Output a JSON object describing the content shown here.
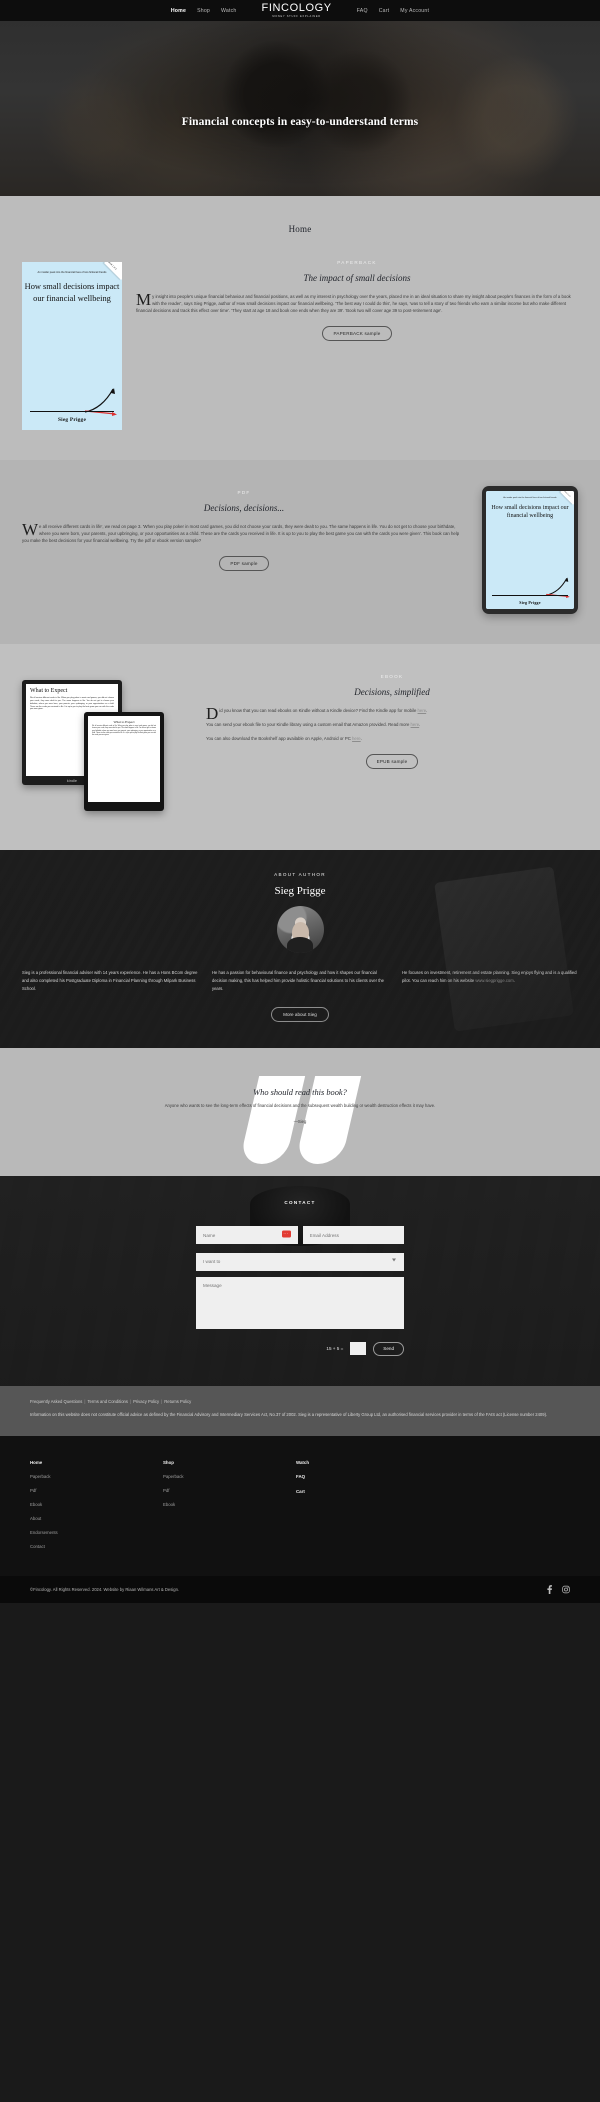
{
  "nav": {
    "left_links": [
      {
        "label": "Home",
        "active": true
      },
      {
        "label": "Shop",
        "active": false
      },
      {
        "label": "Watch",
        "active": false
      }
    ],
    "logo": "FINCOLOGY",
    "logo_tagline": "MONEY STUFF EXPLAINED",
    "right_links": [
      {
        "label": "FAQ"
      },
      {
        "label": "Cart"
      },
      {
        "label": "My Account"
      }
    ]
  },
  "hero": {
    "title": "Financial concepts in easy-to-understand terms"
  },
  "page": {
    "heading": "Home"
  },
  "book_cover": {
    "kicker": "An insider peek into the financial lives of two fictional friends",
    "title": "How small decisions impact our financial wellbeing",
    "author": "Sieg Prigge",
    "corner_badge": "Book 1 of 2"
  },
  "paperback": {
    "eyebrow": "PAPERBACK",
    "title": "The impact of small decisions",
    "dropcap": "M",
    "body": "y insight into people's unique financial behaviour and financial positions, as well as my interest in psychology over the years, placed me in an ideal situation to share my insight about people's finances in the form of a book with the reader', says Sieg Prigge, author of How small decisions impact our financial wellbeing. 'The best way I could do this', he says, 'was to tell a story of two friends who earn a similar income but who make different financial decisions and track this effect over time'. 'They start at age 18 and book one ends when they are 39'. 'Book two will cover age 39 to post-retirement age'.",
    "button": "PAPERBACK sample"
  },
  "pdf": {
    "eyebrow": "PDF",
    "title": "Decisions, decisions...",
    "dropcap": "W",
    "body": "e all receive different cards in life', we read on page 3. 'When you play poker in most card games, you did not choose your cards, they were dealt to you. The same happens in life. You do not get to choose your birthdate, where you were born, your parents, your upbringing, or your opportunities as a child. These are the cards you received in life. It is up to you to play the best game you can with the cards you were given'. This book can help you make the best decisions for your financial wellbeing. Try the pdf or ebook version sample?",
    "button": "PDF sample"
  },
  "ebook": {
    "eyebrow": "EBOOK",
    "title": "Decisions, simplified",
    "dropcap": "D",
    "para1_a": "id you know that you can read ebooks on Kindle without a Kindle device? Find the Kindle app for mobile ",
    "para1_link": "here",
    "para2_a": "You can send your ebook file to your Kindle library using a custom email that Amazon provided. Read more ",
    "para2_link": "here",
    "para3_a": "You can also download the Bookshelf app available on Apple, Android or PC ",
    "para3_link": "here",
    "button": "EPUB sample",
    "kindle_brand": "kindle",
    "kindle_heading": "What to Expect",
    "kindle_excerpt": "We all receive different cards in life. When you play poker in most card games, you did not choose your cards, they were dealt to you. The same happens in life. You do not get to choose your birthdate, where you were born, your parents, your upbringing, or your opportunities as a child. These are the cards you received in life. It is up to you to play the best game you can with the cards you were given."
  },
  "author": {
    "eyebrow": "ABOUT AUTHOR",
    "name": "Sieg Prigge",
    "col1": "Sieg is a professional financial adviser with 14 years experience. He has a Hons BCom degree and also completed his Postgraduate Diploma in Financial Planning through Milpark Business School.",
    "col2": "He has a passion for behavioural finance and psychology and how it shapes our financial decision making, this has helped him provide holistic financial solutions to his clients over the years.",
    "col3_a": "He focuses on investment, retirement and estate planning.  Sieg enjoys flying and is a qualified pilot. You can reach him on his website ",
    "col3_link": "www.siegprigge.com",
    "col3_b": ".",
    "button": "More about Sieg"
  },
  "quote": {
    "title": "Who should read this book?",
    "body": "Anyone who wants to see the long-term effects of financial decisions and the subsequent wealth building or wealth destruction effects it may have.",
    "attribution": "—Sieg"
  },
  "contact": {
    "eyebrow": "CONTACT",
    "name_placeholder": "Name",
    "name_badge": "···",
    "email_placeholder": "Email Address",
    "select_placeholder": "I want to",
    "message_placeholder": "Message",
    "captcha_label": "15 + 5 =",
    "captcha_value": "",
    "send_label": "Send"
  },
  "legal": {
    "links": [
      "Frequently Asked Questions",
      "Terms and Conditions",
      "Privacy Policy",
      "Returns Policy"
    ],
    "text": "Information on this website does not constitute official advice as defined by the Financial Advisory and Intermediary Services Act, No.37 of 2002. Sieg is a representative of Liberty Group Ltd, an authorised financial services provider in terms of the FAIS act (License number 2409)."
  },
  "footer": {
    "columns": [
      {
        "title": "Home",
        "links": [
          "Paperback",
          "Pdf",
          "Ebook",
          "About",
          "Endorsements",
          "Contact"
        ]
      },
      {
        "title": "Shop",
        "links": [
          "Paperback",
          "Pdf",
          "Ebook"
        ]
      },
      {
        "title": "Watch",
        "links": [
          "FAQ",
          "Cart"
        ]
      }
    ],
    "copyright": "©Fincology. All Rights Reserved. 2024. Website by Riaan Wilmans Art & Design."
  }
}
